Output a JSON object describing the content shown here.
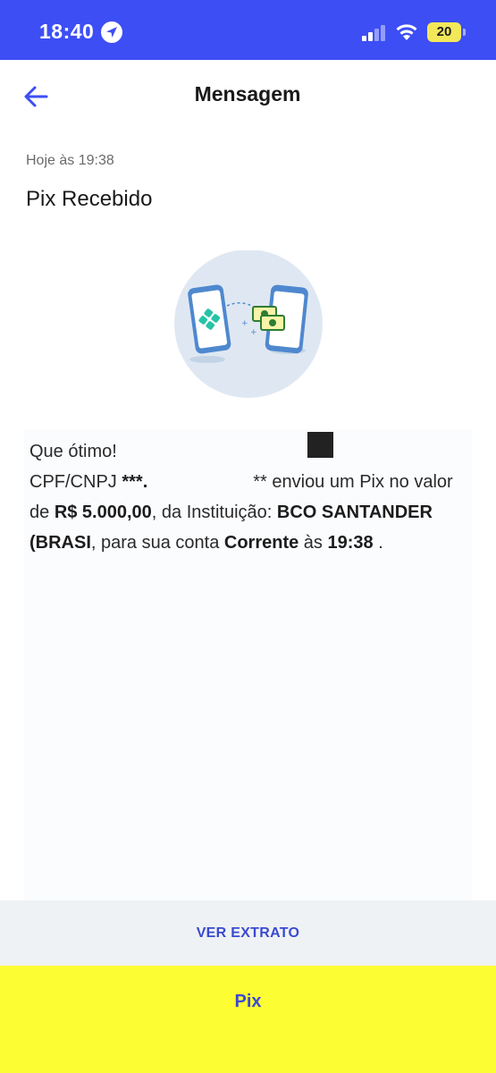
{
  "status_bar": {
    "time": "18:40",
    "battery": "20",
    "icons": [
      "location-arrow-icon",
      "cellular-signal-icon",
      "wifi-icon",
      "battery-icon"
    ],
    "background_color": "#3d4ef5"
  },
  "header": {
    "title": "Mensagem",
    "back_icon": "arrow-left-icon",
    "accent_color": "#3d4ef5"
  },
  "message": {
    "timestamp": "Hoje às 19:38",
    "title": "Pix Recebido",
    "illustration_icon": "pix-phones-transfer-illustration",
    "body": {
      "part1": "Que ótimo! ",
      "part2": "CPF/CNPJ ",
      "cpf_masked": "***.",
      "part3_suffix": "** enviou um Pix no valor de ",
      "amount": "R$ 5.000,00",
      "part4": ", da Instituição: ",
      "institution": "BCO SANTANDER (BRASI",
      "part5": ", para sua conta ",
      "account_type": "Corrente",
      "part6": " às ",
      "time": "19:38",
      "part7": " ."
    }
  },
  "footer": {
    "extrato_label": "VER EXTRATO",
    "pix_label": "Pix",
    "extrato_bg": "#eff2f4",
    "pix_bg": "#fdfd33",
    "label_color": "#3a4ad0"
  }
}
